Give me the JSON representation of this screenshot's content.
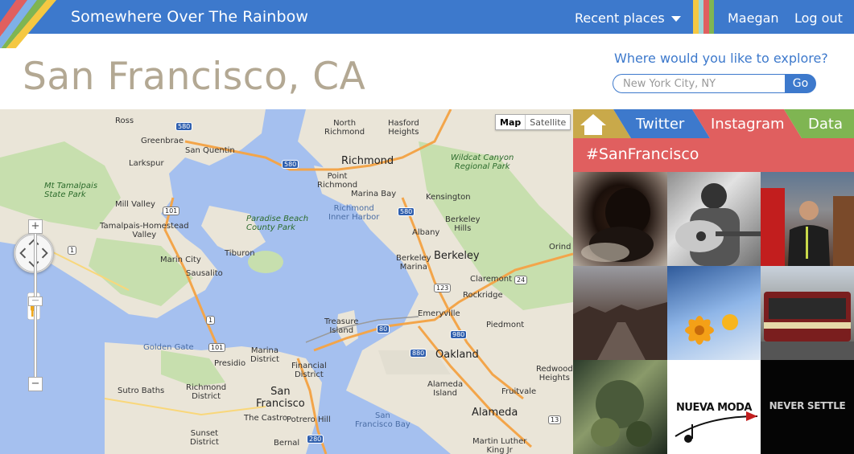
{
  "app": {
    "title": "Somewhere Over The Rainbow",
    "recent_places_label": "Recent places",
    "user_name": "Maegan",
    "logout_label": "Log out",
    "stripe_colors": [
      "#f5c842",
      "#9ed4d7",
      "#e05f5f",
      "#7fb552"
    ]
  },
  "header": {
    "city_title": "San Francisco, CA",
    "explore_label": "Where would you like to explore?",
    "search_placeholder": "New York City, NY",
    "go_label": "Go"
  },
  "map": {
    "type_buttons": [
      "Map",
      "Satellite"
    ],
    "labels": {
      "ross": "Ross",
      "greenbrae": "Greenbrae",
      "larkspur": "Larkspur",
      "san_quentin": "San Quentin",
      "north_richmond": "North\nRichmond",
      "hasford_heights": "Hasford\nHeights",
      "richmond": "Richmond",
      "wildcat": "Wildcat Canyon\nRegional Park",
      "mt_tamalpais": "Mt Tamalpais\nState Park",
      "mill_valley": "Mill Valley",
      "point_richmond": "Point\nRichmond",
      "marina_bay": "Marina Bay",
      "kensington": "Kensington",
      "paradise": "Paradise Beach\nCounty Park",
      "tamalpais_homestead": "Tamalpais-Homestead\nValley",
      "richmond_harbor": "Richmond\nInner Harbor",
      "berkeley_hills": "Berkeley\nHills",
      "albany": "Albany",
      "orinda": "Orind",
      "tiburon": "Tiburon",
      "marin_city": "Marin City",
      "berkeley_marina": "Berkeley\nMarina",
      "berkeley": "Berkeley",
      "sausalito": "Sausalito",
      "claremont": "Claremont",
      "rockridge": "Rockridge",
      "emeryville": "Emeryville",
      "treasure_island": "Treasure\nIsland",
      "piedmont": "Piedmont",
      "golden_gate": "Golden Gate",
      "marina_district": "Marina\nDistrict",
      "financial_district": "Financial\nDistrict",
      "presidio": "Presidio",
      "oakland": "Oakland",
      "redwood_heights": "Redwood\nHeights",
      "sutro_baths": "Sutro Baths",
      "richmond_district": "Richmond\nDistrict",
      "san_francisco": "San\nFrancisco",
      "alameda_island": "Alameda\nIsland",
      "fruitvale": "Fruitvale",
      "alameda": "Alameda",
      "castro": "The Castro",
      "potrero": "Potrero Hill",
      "sunset_district": "Sunset\nDistrict",
      "bernal": "Bernal",
      "sf_bay": "San\nFrancisco Bay",
      "mlk_park": "Martin Luther\nKing Jr"
    },
    "highways": [
      "580",
      "580",
      "101",
      "1",
      "580",
      "123",
      "24",
      "1",
      "80",
      "980",
      "101",
      "880",
      "13",
      "280"
    ]
  },
  "panel": {
    "tabs": [
      "Twitter",
      "Instagram",
      "Data"
    ],
    "hashtag": "#SanFrancisco",
    "tab_colors": {
      "home": "#c9a94a",
      "twitter": "#3d79cc",
      "instagram": "#e05f5f",
      "data": "#7fb552"
    },
    "photo_overlay_texts": [
      "NUEVA MODA",
      "NEVER SETTLE"
    ]
  }
}
